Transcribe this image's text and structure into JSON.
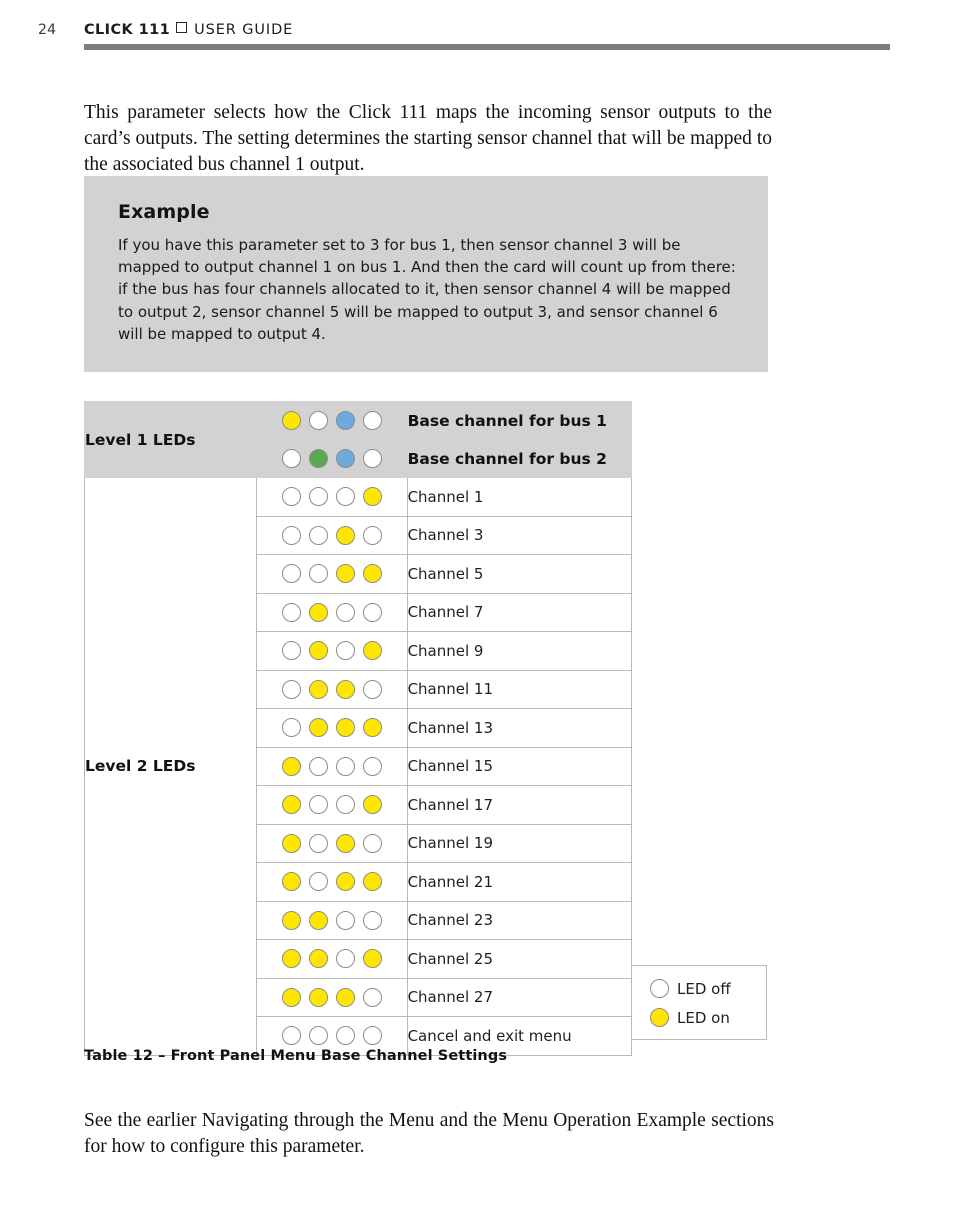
{
  "header": {
    "page_number": "24",
    "brand": "CLICK 111",
    "separator_icon": "square-bullet-icon",
    "doc_title": "USER GUIDE"
  },
  "intro_paragraph": "This parameter selects how the Click 111 maps the incoming sensor outputs to the card’s outputs.  The setting determines the starting sensor channel that will be mapped to the associated bus channel 1 output.",
  "example": {
    "title": "Example",
    "text": "If you have this parameter set to 3 for bus 1, then sensor channel 3 will be mapped to output channel 1 on bus 1. And then the card will count up from there: if the bus has four channels allocated to it, then sensor channel 4 will be mapped to output 2, sensor channel 5 will be mapped to output 3, and sensor channel 6 will be mapped to output 4."
  },
  "table": {
    "level1_label": "Level 1 LEDs",
    "level2_label": "Level 2 LEDs",
    "header_rows": [
      {
        "leds": [
          "on",
          "off",
          "blue",
          "off"
        ],
        "desc": "Base channel for bus 1"
      },
      {
        "leds": [
          "off",
          "green",
          "blue",
          "off"
        ],
        "desc": "Base channel for bus 2"
      }
    ],
    "rows": [
      {
        "leds": [
          "off",
          "off",
          "off",
          "on"
        ],
        "desc": "Channel 1"
      },
      {
        "leds": [
          "off",
          "off",
          "on",
          "off"
        ],
        "desc": "Channel 3"
      },
      {
        "leds": [
          "off",
          "off",
          "on",
          "on"
        ],
        "desc": "Channel 5"
      },
      {
        "leds": [
          "off",
          "on",
          "off",
          "off"
        ],
        "desc": "Channel 7"
      },
      {
        "leds": [
          "off",
          "on",
          "off",
          "on"
        ],
        "desc": "Channel 9"
      },
      {
        "leds": [
          "off",
          "on",
          "on",
          "off"
        ],
        "desc": "Channel 11"
      },
      {
        "leds": [
          "off",
          "on",
          "on",
          "on"
        ],
        "desc": "Channel 13"
      },
      {
        "leds": [
          "on",
          "off",
          "off",
          "off"
        ],
        "desc": "Channel 15"
      },
      {
        "leds": [
          "on",
          "off",
          "off",
          "on"
        ],
        "desc": "Channel 17"
      },
      {
        "leds": [
          "on",
          "off",
          "on",
          "off"
        ],
        "desc": "Channel 19"
      },
      {
        "leds": [
          "on",
          "off",
          "on",
          "on"
        ],
        "desc": "Channel 21"
      },
      {
        "leds": [
          "on",
          "on",
          "off",
          "off"
        ],
        "desc": "Channel 23"
      },
      {
        "leds": [
          "on",
          "on",
          "off",
          "on"
        ],
        "desc": "Channel 25"
      },
      {
        "leds": [
          "on",
          "on",
          "on",
          "off"
        ],
        "desc": "Channel 27"
      },
      {
        "leds": [
          "off",
          "off",
          "off",
          "off"
        ],
        "desc": "Cancel and exit menu"
      }
    ]
  },
  "legend": {
    "off_label": "LED off",
    "on_label": "LED on"
  },
  "caption": "Table 12 – Front Panel Menu Base Channel Settings",
  "outro_paragraph": "See the earlier Navigating through the Menu and the Menu Operation Example sections for how to configure this parameter.",
  "colors": {
    "led_on": "#ffe600",
    "led_green": "#5aa84f",
    "led_blue": "#6fa8dc",
    "led_ring": "#8d8d8d",
    "callout_bg": "#d2d2d2",
    "rule": "#7d7d7d",
    "table_border": "#b9b9b9"
  }
}
